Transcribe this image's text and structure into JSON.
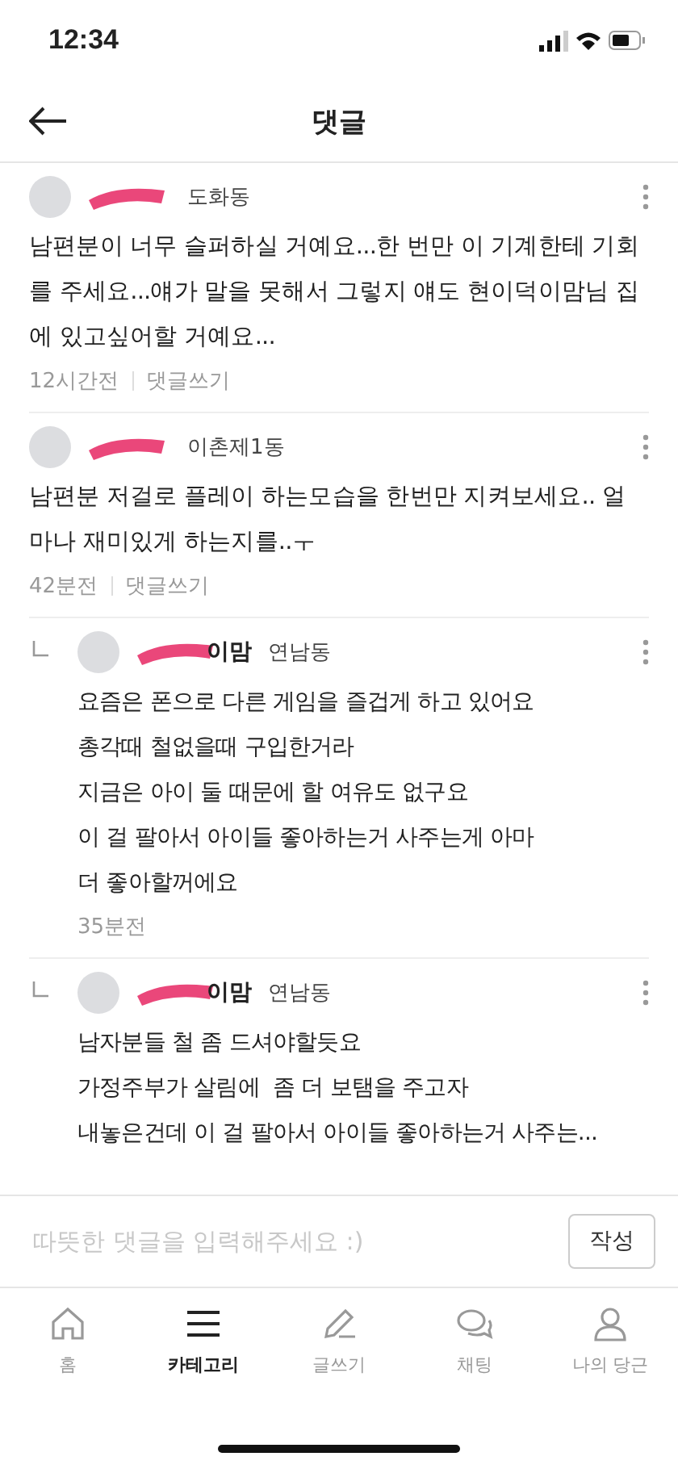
{
  "status_bar": {
    "time": "12:34"
  },
  "header": {
    "title": "댓글"
  },
  "comments": [
    {
      "reply": false,
      "location": "도화동",
      "text": "남편분이 너무 슬퍼하실 거예요...한 번만 이 기계한테 기회를 주세요...얘가 말을 못해서 그렇지 얘도 현이덕이맘님 집에 있고싶어할 거예요...",
      "time": "12시간전",
      "reply_link": "댓글쓰기"
    },
    {
      "reply": false,
      "location": "이촌제1동",
      "text": "남편분 저걸로 플레이 하는모습을 한번만 지켜보세요.. 얼마나 재미있게 하는지를..ㅜ",
      "time": "42분전",
      "reply_link": "댓글쓰기"
    },
    {
      "reply": true,
      "author_visible": "이맘",
      "location": "연남동",
      "text": "요즘은 폰으로 다른 게임을 즐겁게 하고 있어요\n총각때 철없을때 구입한거라\n지금은 아이 둘 때문에 할 여유도 없구요\n이 걸 팔아서 아이들 좋아하는거 사주는게 아마\n더 좋아할꺼에요",
      "time": "35분전"
    },
    {
      "reply": true,
      "author_visible": "이맘",
      "location": "연남동",
      "text": "남자분들 철 좀 드셔야할듯요\n가정주부가 살림에  좀 더 보탬을 주고자\n내놓은건데 이 걸 팔아서 아이들 좋아하는거 사주는..."
    }
  ],
  "input": {
    "placeholder": "따뜻한 댓글을 입력해주세요 :)",
    "button": "작성"
  },
  "nav": [
    {
      "kind": "home",
      "label": "홈",
      "selected": false
    },
    {
      "kind": "menu",
      "label": "카테고리",
      "selected": true
    },
    {
      "kind": "write",
      "label": "글쓰기",
      "selected": false
    },
    {
      "kind": "chat",
      "label": "채팅",
      "selected": false
    },
    {
      "kind": "person",
      "label": "나의 당근",
      "selected": false
    }
  ]
}
